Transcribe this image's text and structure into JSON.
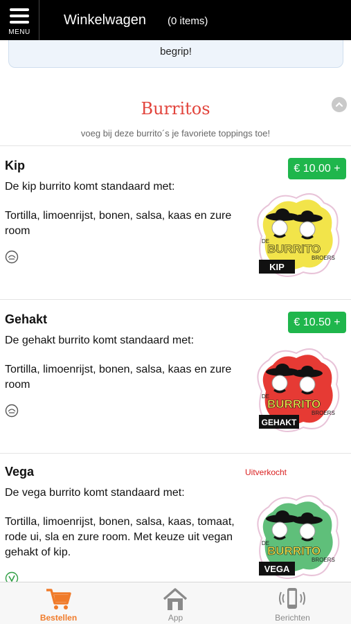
{
  "header": {
    "menu_label": "MENU",
    "title": "Winkelwagen",
    "count": "(0 items)"
  },
  "notice": {
    "text": "begrip!"
  },
  "section": {
    "title": "Burritos",
    "subtitle": "voeg bij deze burrito´s je favoriete toppings toe!"
  },
  "products": [
    {
      "name": "Kip",
      "intro": "De kip burrito komt standaard met:",
      "description": "Tortilla, limoenrijst, bonen, salsa, kaas en zure room",
      "price": "€ 10.00 +",
      "logo_top": "DE",
      "logo_brand": "BURRITO",
      "logo_bottom": "BROERS",
      "logo_tag": "KIP",
      "logo_color": "#f2e44a"
    },
    {
      "name": "Gehakt",
      "intro": "De gehakt burrito komt standaard met:",
      "description": "Tortilla, limoenrijst, bonen, salsa, kaas en zure room",
      "price": "€ 10.50 +",
      "logo_top": "DE",
      "logo_brand": "BURRITO",
      "logo_bottom": "BROERS",
      "logo_tag": "GEHAKT",
      "logo_color": "#e63a34"
    },
    {
      "name": "Vega",
      "intro": "De vega burrito komt standaard met:",
      "description": "Tortilla, limoenrijst, bonen, salsa, kaas, tomaat, rode ui, sla en zure room. Met keuze uit vegan gehakt of kip.",
      "status": "Uitverkocht",
      "logo_top": "DE",
      "logo_brand": "BURRITO",
      "logo_bottom": "BROERS",
      "logo_tag": "VEGA",
      "logo_color": "#5fbf7a"
    }
  ],
  "bottom_nav": [
    {
      "label": "Bestellen",
      "icon": "cart-icon",
      "active": true
    },
    {
      "label": "App",
      "icon": "home-icon",
      "active": false
    },
    {
      "label": "Berichten",
      "icon": "phone-icon",
      "active": false
    }
  ],
  "colors": {
    "accent": "#f07b2a",
    "price_green": "#1fb64c",
    "title_red": "#e2443c",
    "soldout_red": "#d91f1f"
  }
}
